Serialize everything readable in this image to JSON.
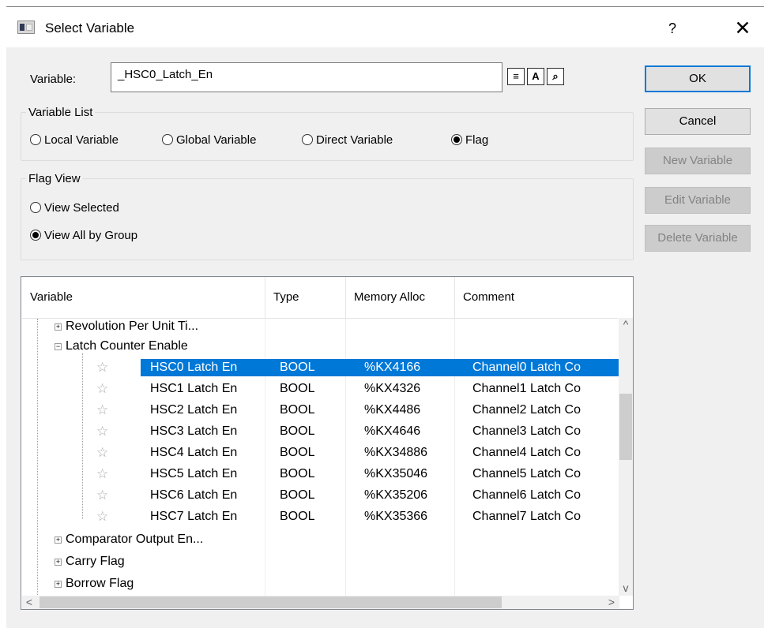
{
  "window": {
    "title": "Select Variable",
    "help_glyph": "?",
    "close_glyph": "✕"
  },
  "variable_field": {
    "label": "Variable:",
    "value": "_HSC0_Latch_En"
  },
  "tool_icons": [
    "variable-list-icon",
    "text-format-icon",
    "find-variable-icon"
  ],
  "tool_glyphs": [
    "≡",
    "A",
    "⌕"
  ],
  "buttons": {
    "ok": "OK",
    "cancel": "Cancel",
    "new_variable": "New Variable",
    "edit_variable": "Edit Variable",
    "delete_variable": "Delete Variable"
  },
  "variable_list": {
    "legend": "Variable List",
    "options": [
      "Local Variable",
      "Global Variable",
      "Direct Variable",
      "Flag"
    ],
    "selected": "Flag"
  },
  "flag_view": {
    "legend": "Flag View",
    "options": [
      "View Selected",
      "View All by Group"
    ],
    "selected": "View All by Group"
  },
  "table": {
    "columns": [
      "Variable",
      "Type",
      "Memory Alloc",
      "Comment"
    ],
    "groups_before": [
      {
        "label": "Revolution Per Unit Ti...",
        "expanded": false
      }
    ],
    "open_group": {
      "label": "Latch Counter Enable",
      "expanded": true
    },
    "rows": [
      {
        "name": "HSC0  Latch  En",
        "type": "BOOL",
        "mem": "%KX4166",
        "comment": "Channel0 Latch Co",
        "selected": true
      },
      {
        "name": "HSC1  Latch  En",
        "type": "BOOL",
        "mem": "%KX4326",
        "comment": "Channel1 Latch Co",
        "selected": false
      },
      {
        "name": "HSC2  Latch  En",
        "type": "BOOL",
        "mem": "%KX4486",
        "comment": "Channel2 Latch Co",
        "selected": false
      },
      {
        "name": "HSC3  Latch  En",
        "type": "BOOL",
        "mem": "%KX4646",
        "comment": "Channel3 Latch Co",
        "selected": false
      },
      {
        "name": "HSC4  Latch  En",
        "type": "BOOL",
        "mem": "%KX34886",
        "comment": "Channel4 Latch Co",
        "selected": false
      },
      {
        "name": "HSC5  Latch  En",
        "type": "BOOL",
        "mem": "%KX35046",
        "comment": "Channel5 Latch Co",
        "selected": false
      },
      {
        "name": "HSC6  Latch  En",
        "type": "BOOL",
        "mem": "%KX35206",
        "comment": "Channel6 Latch Co",
        "selected": false
      },
      {
        "name": "HSC7  Latch  En",
        "type": "BOOL",
        "mem": "%KX35366",
        "comment": "Channel7 Latch Co",
        "selected": false
      }
    ],
    "groups_after": [
      {
        "label": "Comparator Output En...",
        "expanded": false
      },
      {
        "label": "Carry Flag",
        "expanded": false
      },
      {
        "label": "Borrow Flag",
        "expanded": false
      }
    ],
    "scroll": {
      "up": "^",
      "down": "v",
      "left": "<",
      "right": ">"
    }
  }
}
